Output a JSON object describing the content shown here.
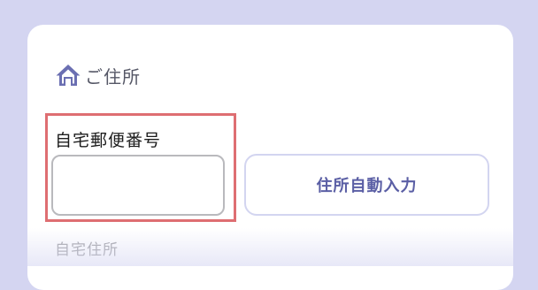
{
  "section": {
    "title": "ご住所",
    "icon": "home-icon"
  },
  "zip_field": {
    "label": "自宅郵便番号",
    "value": "",
    "placeholder": ""
  },
  "auto_fill_button": {
    "label": "住所自動入力"
  },
  "address_field": {
    "label": "自宅住所"
  },
  "colors": {
    "page_background": "#d4d5f1",
    "accent": "#6b6fb2",
    "highlight_border": "#de6e72"
  }
}
